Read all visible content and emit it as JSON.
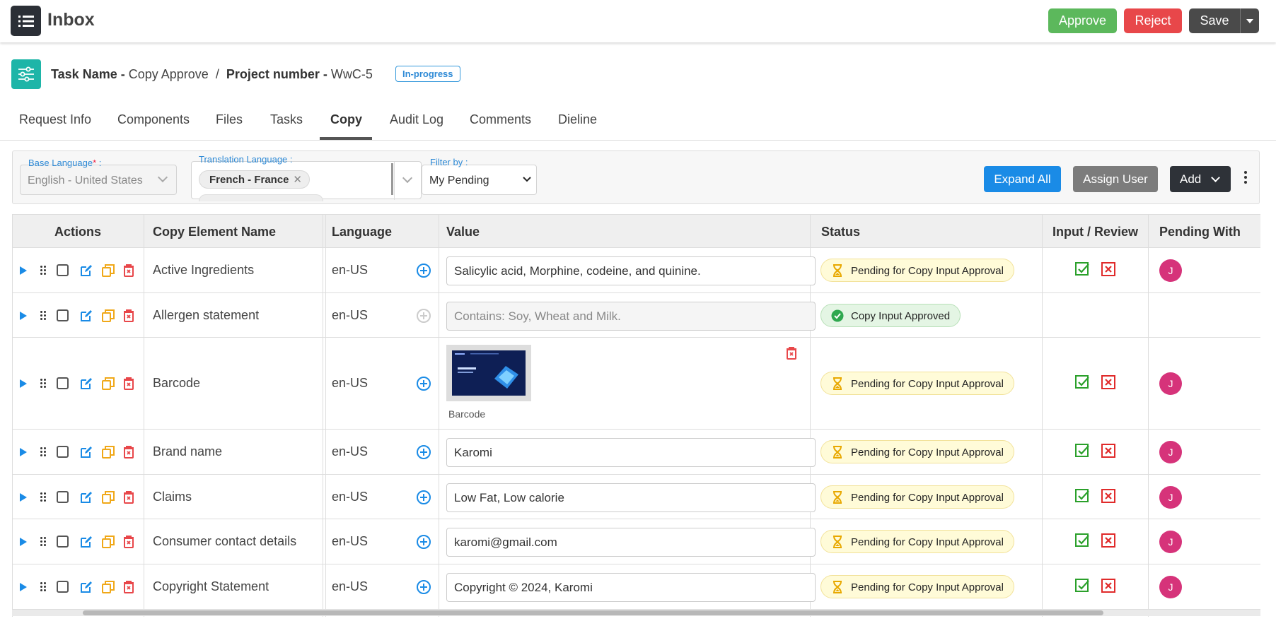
{
  "header": {
    "title": "Inbox",
    "approve_label": "Approve",
    "reject_label": "Reject",
    "save_label": "Save"
  },
  "task": {
    "task_name_label": "Task Name",
    "task_name_value": "Copy Approve",
    "separator": "/",
    "project_label": "Project number",
    "project_value": "WwC-5",
    "status": "In-progress"
  },
  "tabs": [
    "Request Info",
    "Components",
    "Files",
    "Tasks",
    "Copy",
    "Audit Log",
    "Comments",
    "Dieline"
  ],
  "active_tab": "Copy",
  "filters": {
    "base_language_label": "Base Language",
    "base_language_value": "English - United States",
    "translation_language_label": "Translation Language :",
    "translation_chip": "French - France",
    "filter_by_label": "Filter by :",
    "filter_by_value": "My Pending",
    "expand_all_label": "Expand All",
    "assign_user_label": "Assign User",
    "add_label": "Add"
  },
  "table": {
    "headers": [
      "Actions",
      "Copy Element Name",
      "Language",
      "Value",
      "Status",
      "Input / Review",
      "Pending With"
    ],
    "rows": [
      {
        "name": "Active Ingredients",
        "language": "en-US",
        "value": "Salicylic acid, Morphine, codeine, and quinine.",
        "status": "Pending for Copy Input Approval",
        "status_type": "pending",
        "avatar": "J"
      },
      {
        "name": "Allergen statement",
        "language": "en-US",
        "value": "Contains: Soy, Wheat and Milk.",
        "status": "Copy Input Approved",
        "status_type": "approved",
        "avatar": ""
      },
      {
        "name": "Barcode",
        "language": "en-US",
        "value": "Barcode",
        "status": "Pending for Copy Input Approval",
        "status_type": "pending",
        "avatar": "J"
      },
      {
        "name": "Brand name",
        "language": "en-US",
        "value": "Karomi",
        "status": "Pending for Copy Input Approval",
        "status_type": "pending",
        "avatar": "J"
      },
      {
        "name": "Claims",
        "language": "en-US",
        "value": "Low Fat, Low calorie",
        "status": "Pending for Copy Input Approval",
        "status_type": "pending",
        "avatar": "J"
      },
      {
        "name": "Consumer contact details",
        "language": "en-US",
        "value": "karomi@gmail.com",
        "status": "Pending for Copy Input Approval",
        "status_type": "pending",
        "avatar": "J"
      },
      {
        "name": "Copyright Statement",
        "language": "en-US",
        "value": "Copyright © 2024, Karomi",
        "status": "Pending for Copy Input Approval",
        "status_type": "pending",
        "avatar": "J"
      }
    ]
  },
  "colors": {
    "primary": "#1a8be6",
    "approve": "#5cb85c",
    "reject": "#e8474a",
    "teal": "#1eb5a8",
    "avatar": "#d6337a"
  }
}
